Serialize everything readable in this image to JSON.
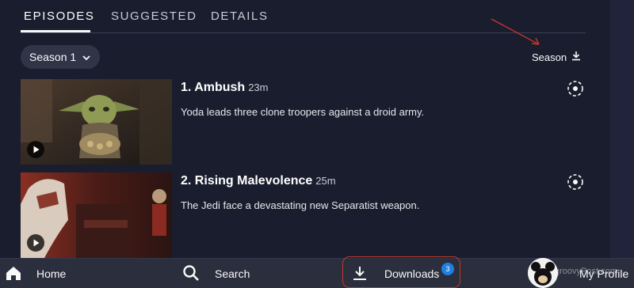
{
  "tabs": [
    {
      "label": "EPISODES",
      "active": true
    },
    {
      "label": "SUGGESTED",
      "active": false
    },
    {
      "label": "DETAILS",
      "active": false
    }
  ],
  "season_selector": {
    "value": "Season 1"
  },
  "season_download": {
    "label": "Season"
  },
  "episodes": [
    {
      "title": "1. Ambush",
      "duration": "23m",
      "description": "Yoda leads three clone troopers against a droid army."
    },
    {
      "title": "2. Rising Malevolence",
      "duration": "25m",
      "description": "The Jedi face a devastating new Separatist weapon."
    }
  ],
  "bottom_nav": {
    "home": "Home",
    "search": "Search",
    "downloads": "Downloads",
    "downloads_badge": "3",
    "profile": "My Profile"
  },
  "watermark": "groovyPost.com",
  "colors": {
    "background": "#1a1d2e",
    "nav_background": "#2b2e3d",
    "badge": "#1f80e0",
    "annotation_red": "#c0392b"
  },
  "icons": [
    "chevron-down-icon",
    "download-icon",
    "play-icon",
    "home-icon",
    "search-icon",
    "avatar"
  ]
}
